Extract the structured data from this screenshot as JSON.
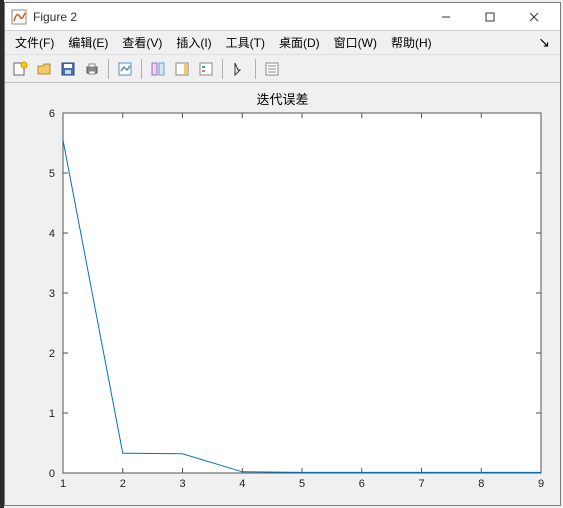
{
  "window": {
    "title": "Figure 2"
  },
  "menu": {
    "items": [
      "文件(F)",
      "编辑(E)",
      "查看(V)",
      "插入(I)",
      "工具(T)",
      "桌面(D)",
      "窗口(W)",
      "帮助(H)"
    ]
  },
  "toolbar": {
    "icons": [
      "new-icon",
      "open-icon",
      "save-icon",
      "print-icon",
      "sep",
      "link-icon",
      "sep",
      "data-cursor-icon",
      "colorbar-icon",
      "legend-icon",
      "sep",
      "pointer-icon",
      "sep",
      "property-editor-icon"
    ]
  },
  "chart_data": {
    "type": "line",
    "title": "迭代误差",
    "xlabel": "",
    "ylabel": "",
    "x": [
      1,
      2,
      3,
      4,
      5,
      6,
      7,
      8,
      9
    ],
    "y": [
      5.55,
      0.33,
      0.32,
      0.02,
      0.01,
      0.01,
      0.01,
      0.01,
      0.01
    ],
    "xlim": [
      1,
      9
    ],
    "ylim": [
      0,
      6
    ],
    "xticks": [
      1,
      2,
      3,
      4,
      5,
      6,
      7,
      8,
      9
    ],
    "yticks": [
      0,
      1,
      2,
      3,
      4,
      5,
      6
    ]
  }
}
